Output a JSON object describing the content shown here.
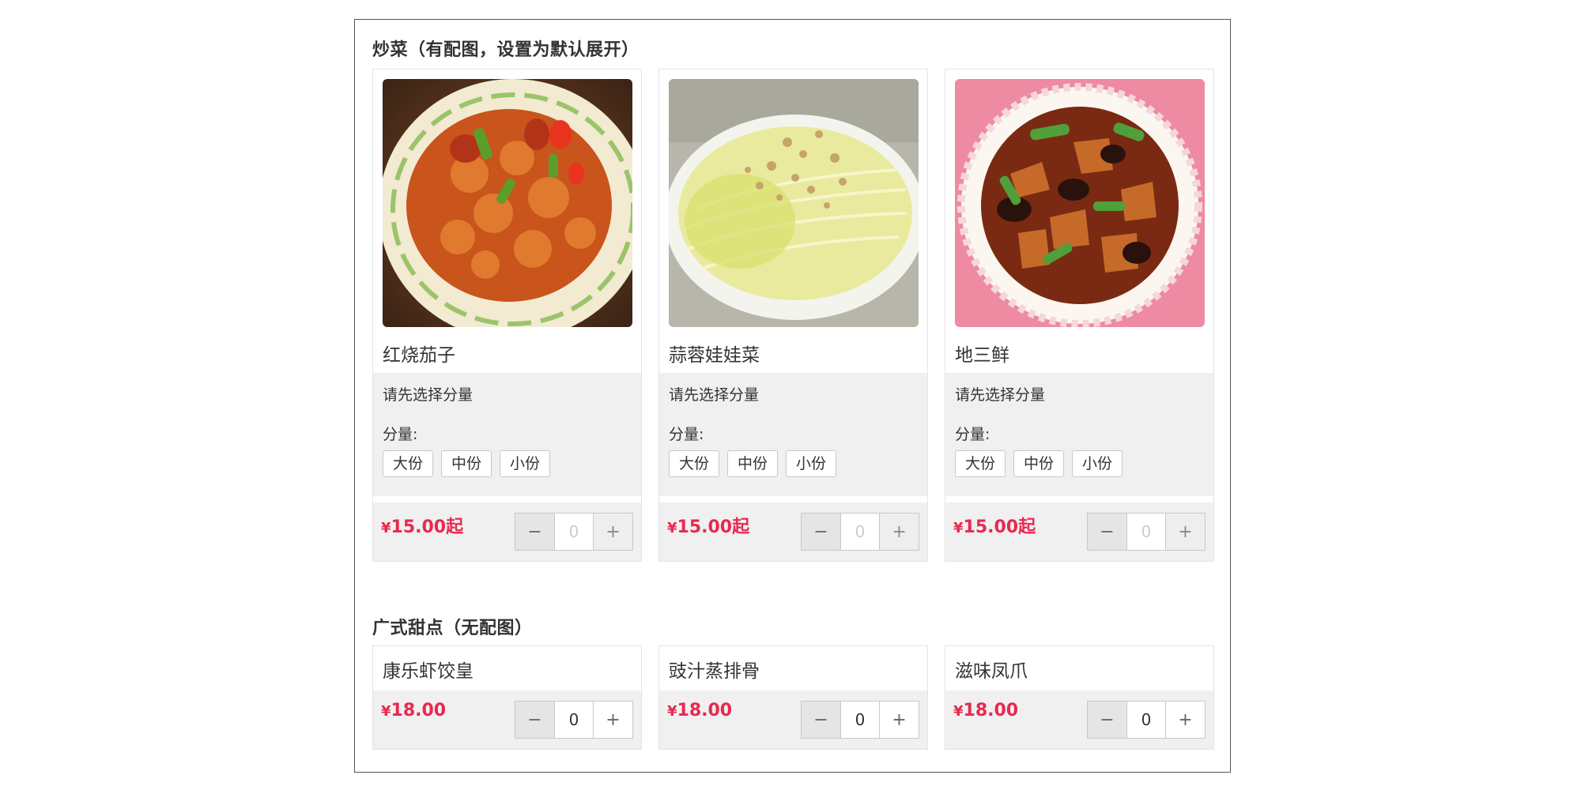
{
  "sections": [
    {
      "title": "炒菜（有配图，设置为默认展开）",
      "items": [
        {
          "name": "红烧茄子",
          "photo": "braised-dish-photo",
          "hint": "请先选择分量",
          "size_label": "分量:",
          "sizes": [
            "大份",
            "中份",
            "小份"
          ],
          "currency": "¥",
          "price": "15.00起",
          "quantity": "0"
        },
        {
          "name": "蒜蓉娃娃菜",
          "photo": "baby-cabbage-photo",
          "hint": "请先选择分量",
          "size_label": "分量:",
          "sizes": [
            "大份",
            "中份",
            "小份"
          ],
          "currency": "¥",
          "price": "15.00起",
          "quantity": "0"
        },
        {
          "name": "地三鲜",
          "photo": "di-san-xian-photo",
          "hint": "请先选择分量",
          "size_label": "分量:",
          "sizes": [
            "大份",
            "中份",
            "小份"
          ],
          "currency": "¥",
          "price": "15.00起",
          "quantity": "0"
        }
      ]
    },
    {
      "title": "广式甜点（无配图）",
      "items": [
        {
          "name": "康乐虾饺皇",
          "currency": "¥",
          "price": "18.00",
          "quantity": "0"
        },
        {
          "name": "豉汁蒸排骨",
          "currency": "¥",
          "price": "18.00",
          "quantity": "0"
        },
        {
          "name": "滋味凤爪",
          "currency": "¥",
          "price": "18.00",
          "quantity": "0"
        }
      ]
    }
  ],
  "stepper": {
    "minus": "−",
    "plus": "+"
  },
  "colors": {
    "price": "#e8294f",
    "panel": "#f0f0f0",
    "border": "#e4e4e4"
  }
}
